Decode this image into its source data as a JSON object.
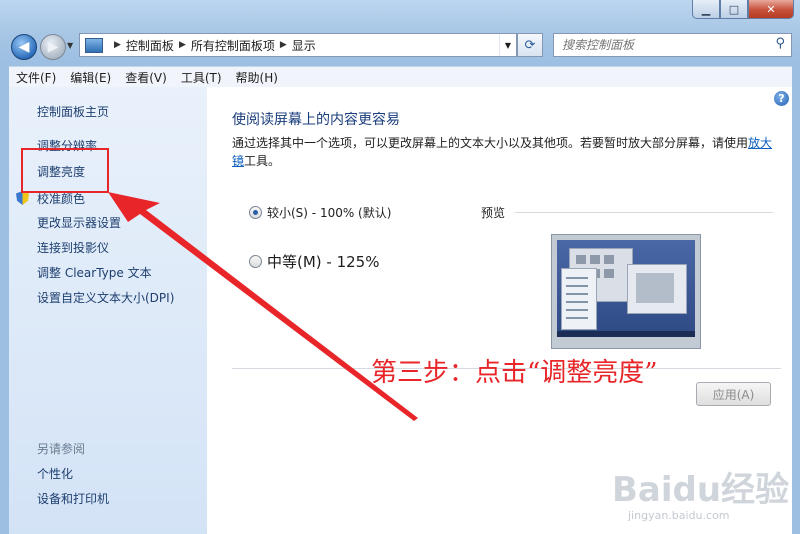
{
  "window": {
    "minimize_icon": "minimize-icon",
    "maximize_icon": "maximize-icon",
    "close_icon": "close-icon"
  },
  "address_bar": {
    "crumbs": [
      "控制面板",
      "所有控制面板项",
      "显示"
    ]
  },
  "search": {
    "placeholder": "搜索控制面板"
  },
  "menu": [
    "文件(F)",
    "编辑(E)",
    "查看(V)",
    "工具(T)",
    "帮助(H)"
  ],
  "sidebar": {
    "home": "控制面板主页",
    "links": [
      "调整分辨率",
      "调整亮度",
      "校准颜色",
      "更改显示器设置",
      "连接到投影仪",
      "调整 ClearType 文本",
      "设置自定义文本大小(DPI)"
    ],
    "see_also_label": "另请参阅",
    "see_also": [
      "个性化",
      "设备和打印机"
    ]
  },
  "main": {
    "title": "使阅读屏幕上的内容更容易",
    "description": "通过选择其中一个选项，可以更改屏幕上的文本大小以及其他项。若要暂时放大部分屏幕，请使用",
    "magnifier_link": "放大镜",
    "description_tail": "工具。",
    "options": [
      {
        "label": "较小(S) - 100% (默认)",
        "selected": true
      },
      {
        "label": "中等(M) - 125%",
        "selected": false
      }
    ],
    "preview_label": "预览",
    "apply_button": "应用(A)"
  },
  "annotation": {
    "text": "第三步：点击“调整亮度”",
    "color": "#e8262a"
  },
  "watermark": {
    "brand": "Baidu经验",
    "url": "jingyan.baidu.com"
  }
}
